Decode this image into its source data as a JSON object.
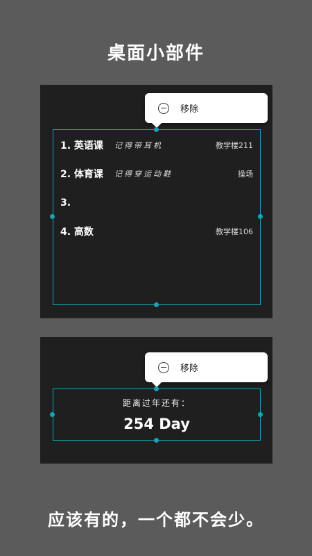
{
  "title": "桌面小部件",
  "schedule_widget": {
    "popup_label": "移除",
    "rows": [
      {
        "name": "1. 英语课",
        "note": "记得带耳机",
        "place": "教学楼211"
      },
      {
        "name": "2. 体育课",
        "note": "记得穿运动鞋",
        "place": "操场"
      },
      {
        "name": "3.",
        "note": "",
        "place": ""
      },
      {
        "name": "4. 高数",
        "note": "",
        "place": "教学楼106"
      }
    ]
  },
  "countdown_widget": {
    "popup_label": "移除",
    "label": "距离过年还有：",
    "value": "254 Day"
  },
  "footer": "应该有的，一个都不会少。",
  "colors": {
    "background": "#5b5b5b",
    "panel": "#1f1f1f",
    "accent": "#17a2b8"
  }
}
